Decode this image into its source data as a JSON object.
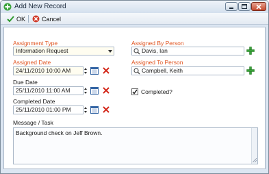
{
  "window": {
    "title": "Add New Record"
  },
  "toolbar": {
    "ok_label": "OK",
    "cancel_label": "Cancel"
  },
  "form": {
    "assignment_type": {
      "label": "Assignment Type",
      "value": "Information Request"
    },
    "assigned_by": {
      "label": "Assigned By Person",
      "value": "Davis, Ian"
    },
    "assigned_date": {
      "label": "Assigned Date",
      "value": "24/11/2010 10:00 AM"
    },
    "assigned_to": {
      "label": "Assigned To Person",
      "value": "Campbell, Keith"
    },
    "due_date": {
      "label": "Due Date",
      "value": "25/11/2010 11:00 AM"
    },
    "completed": {
      "label": "Completed?",
      "checked": true
    },
    "completed_date": {
      "label": "Completed Date",
      "value": "25/11/2010 01:00 PM"
    },
    "message": {
      "label": "Message / Task",
      "value": "Background check on Jeff Brown."
    }
  },
  "colors": {
    "required_label": "#e0531f",
    "field_bg": "#fffdf0"
  }
}
